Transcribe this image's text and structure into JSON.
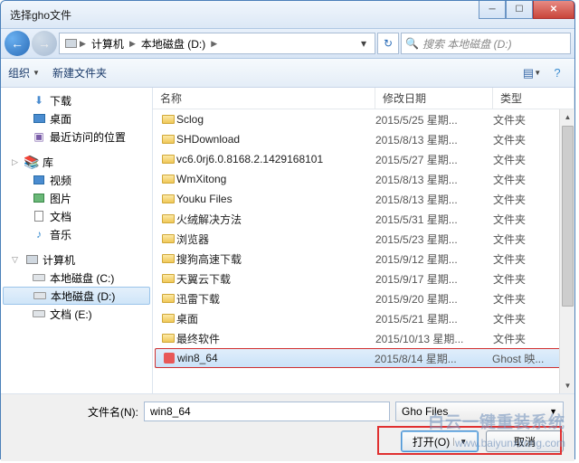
{
  "title": "选择gho文件",
  "window_controls": {
    "close": "✕"
  },
  "nav": {
    "breadcrumb": [
      "计算机",
      "本地磁盘 (D:)"
    ],
    "search_placeholder": "搜索 本地磁盘 (D:)"
  },
  "toolbar": {
    "organize": "组织",
    "new_folder": "新建文件夹"
  },
  "sidebar": {
    "favorites": [
      {
        "icon": "download",
        "label": "下载"
      },
      {
        "icon": "desktop",
        "label": "桌面"
      },
      {
        "icon": "recent",
        "label": "最近访问的位置"
      }
    ],
    "libraries_label": "库",
    "libraries": [
      {
        "icon": "video",
        "label": "视频"
      },
      {
        "icon": "pic",
        "label": "图片"
      },
      {
        "icon": "doc",
        "label": "文档"
      },
      {
        "icon": "music",
        "label": "音乐"
      }
    ],
    "computer_label": "计算机",
    "drives": [
      {
        "label": "本地磁盘 (C:)"
      },
      {
        "label": "本地磁盘 (D:)",
        "selected": true
      },
      {
        "label": "文档 (E:)"
      }
    ]
  },
  "columns": {
    "name": "名称",
    "date": "修改日期",
    "type": "类型"
  },
  "files": [
    {
      "name": "Sclog",
      "date": "2015/5/25 星期...",
      "type": "文件夹",
      "kind": "folder"
    },
    {
      "name": "SHDownload",
      "date": "2015/8/13 星期...",
      "type": "文件夹",
      "kind": "folder"
    },
    {
      "name": "vc6.0rj6.0.8168.2.1429168101",
      "date": "2015/5/27 星期...",
      "type": "文件夹",
      "kind": "folder"
    },
    {
      "name": "WmXitong",
      "date": "2015/8/13 星期...",
      "type": "文件夹",
      "kind": "folder"
    },
    {
      "name": "Youku Files",
      "date": "2015/8/13 星期...",
      "type": "文件夹",
      "kind": "folder"
    },
    {
      "name": "火绒解决方法",
      "date": "2015/5/31 星期...",
      "type": "文件夹",
      "kind": "folder"
    },
    {
      "name": "浏览器",
      "date": "2015/5/23 星期...",
      "type": "文件夹",
      "kind": "folder"
    },
    {
      "name": "搜狗高速下载",
      "date": "2015/9/12 星期...",
      "type": "文件夹",
      "kind": "folder"
    },
    {
      "name": "天翼云下载",
      "date": "2015/9/17 星期...",
      "type": "文件夹",
      "kind": "folder"
    },
    {
      "name": "迅雷下载",
      "date": "2015/9/20 星期...",
      "type": "文件夹",
      "kind": "folder"
    },
    {
      "name": "桌面",
      "date": "2015/5/21 星期...",
      "type": "文件夹",
      "kind": "folder"
    },
    {
      "name": "最终软件",
      "date": "2015/10/13 星期...",
      "type": "文件夹",
      "kind": "folder"
    },
    {
      "name": "win8_64",
      "date": "2015/8/14 星期...",
      "type": "Ghost 映...",
      "kind": "ghost",
      "selected": true,
      "highlighted": true
    }
  ],
  "footer": {
    "filename_label": "文件名(N):",
    "filename_value": "win8_64",
    "filter": "Gho Files",
    "open": "打开(O)",
    "cancel": "取消"
  },
  "watermark": {
    "text": "白云一键重装系统",
    "url": "www.baiyunxitong.com"
  }
}
